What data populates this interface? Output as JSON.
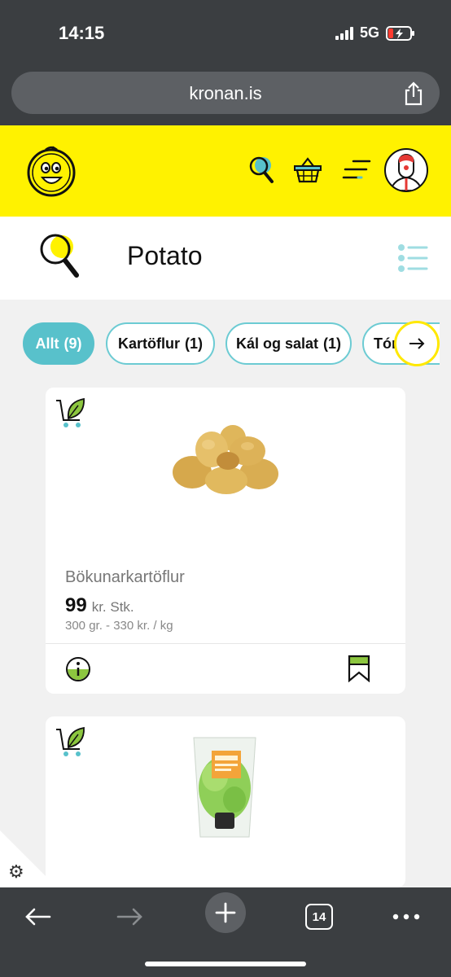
{
  "status": {
    "time": "14:15",
    "network": "5G"
  },
  "browser": {
    "url": "kronan.is",
    "tab_count": "14"
  },
  "search": {
    "query": "Potato"
  },
  "filters": [
    {
      "label": "Allt",
      "count": "(9)",
      "active": true
    },
    {
      "label": "Kartöflur",
      "count": "(1)",
      "active": false
    },
    {
      "label": "Kál og salat",
      "count": "(1)",
      "active": false
    },
    {
      "label": "Tóm",
      "count": "",
      "active": false
    }
  ],
  "products": [
    {
      "name": "Bökunarkartöflur",
      "price": "99",
      "price_unit": "kr. Stk.",
      "price_per": "300 gr. - 330 kr. / kg"
    }
  ],
  "colors": {
    "brand_yellow": "#fff200",
    "accent_teal": "#58c1cb",
    "browser_chrome": "#3b3e41"
  },
  "icons": [
    "search-icon",
    "basket-icon",
    "menu-icon",
    "avatar",
    "list-view-icon",
    "eco-cart-icon",
    "info-icon",
    "bookmark-icon",
    "settings-icon",
    "back-icon",
    "forward-icon",
    "new-tab-icon",
    "tabs-icon",
    "more-icon",
    "share-icon"
  ]
}
